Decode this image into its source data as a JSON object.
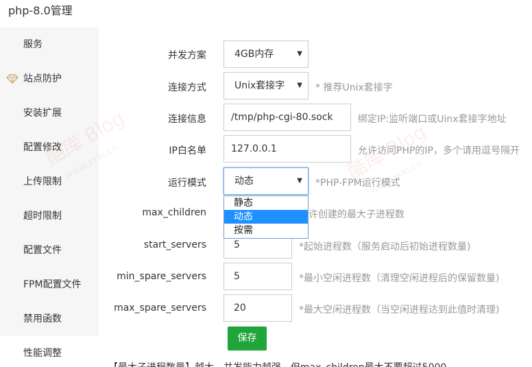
{
  "window": {
    "title": "php-8.0管理"
  },
  "sidebar": {
    "items": [
      {
        "label": "服务"
      },
      {
        "label": "站点防护"
      },
      {
        "label": "安装扩展"
      },
      {
        "label": "配置修改"
      },
      {
        "label": "上传限制"
      },
      {
        "label": "超时限制"
      },
      {
        "label": "配置文件"
      },
      {
        "label": "FPM配置文件"
      },
      {
        "label": "禁用函数"
      },
      {
        "label": "性能调整"
      }
    ],
    "active": "性能调整"
  },
  "form": {
    "concurrency": {
      "label": "并发方案",
      "value": "4GB内存"
    },
    "conn_method": {
      "label": "连接方式",
      "value": "Unix套接字",
      "hint": "* 推荐Unix套接字"
    },
    "conn_info": {
      "label": "连接信息",
      "value": "/tmp/php-cgi-80.sock",
      "hint": "绑定IP:监听端口或Uinx套接字地址"
    },
    "ip_whitelist": {
      "label": "IP白名单",
      "value": "127.0.0.1",
      "hint": "允许访问PHP的IP，多个请用逗号隔开"
    },
    "run_mode": {
      "label": "运行模式",
      "value": "动态",
      "hint": "*PHP-FPM运行模式",
      "options": [
        "静态",
        "动态",
        "按需"
      ]
    },
    "max_children": {
      "label": "max_children",
      "hint": "允许创建的最大子进程数"
    },
    "start_servers": {
      "label": "start_servers",
      "value": "5",
      "hint": "*起始进程数（服务启动后初始进程数量)"
    },
    "min_spare_servers": {
      "label": "min_spare_servers",
      "value": "5",
      "hint": "*最小空闲进程数（清理空闲进程后的保留数量)"
    },
    "max_spare_servers": {
      "label": "max_spare_servers",
      "value": "20",
      "hint": "*最大空闲进程数（当空闲进程达到此值时清理)"
    },
    "save_label": "保存"
  },
  "footer_note": "【最大子进程数量】越大，并发能力越强，但max_children最大不要超过5000",
  "watermark": {
    "cn": "酷库 Blog",
    "url": "www.zxki.cn"
  },
  "colors": {
    "accent": "#20a53a",
    "focus": "#6aa6e8",
    "dropdown_selected": "#1e90ff"
  }
}
